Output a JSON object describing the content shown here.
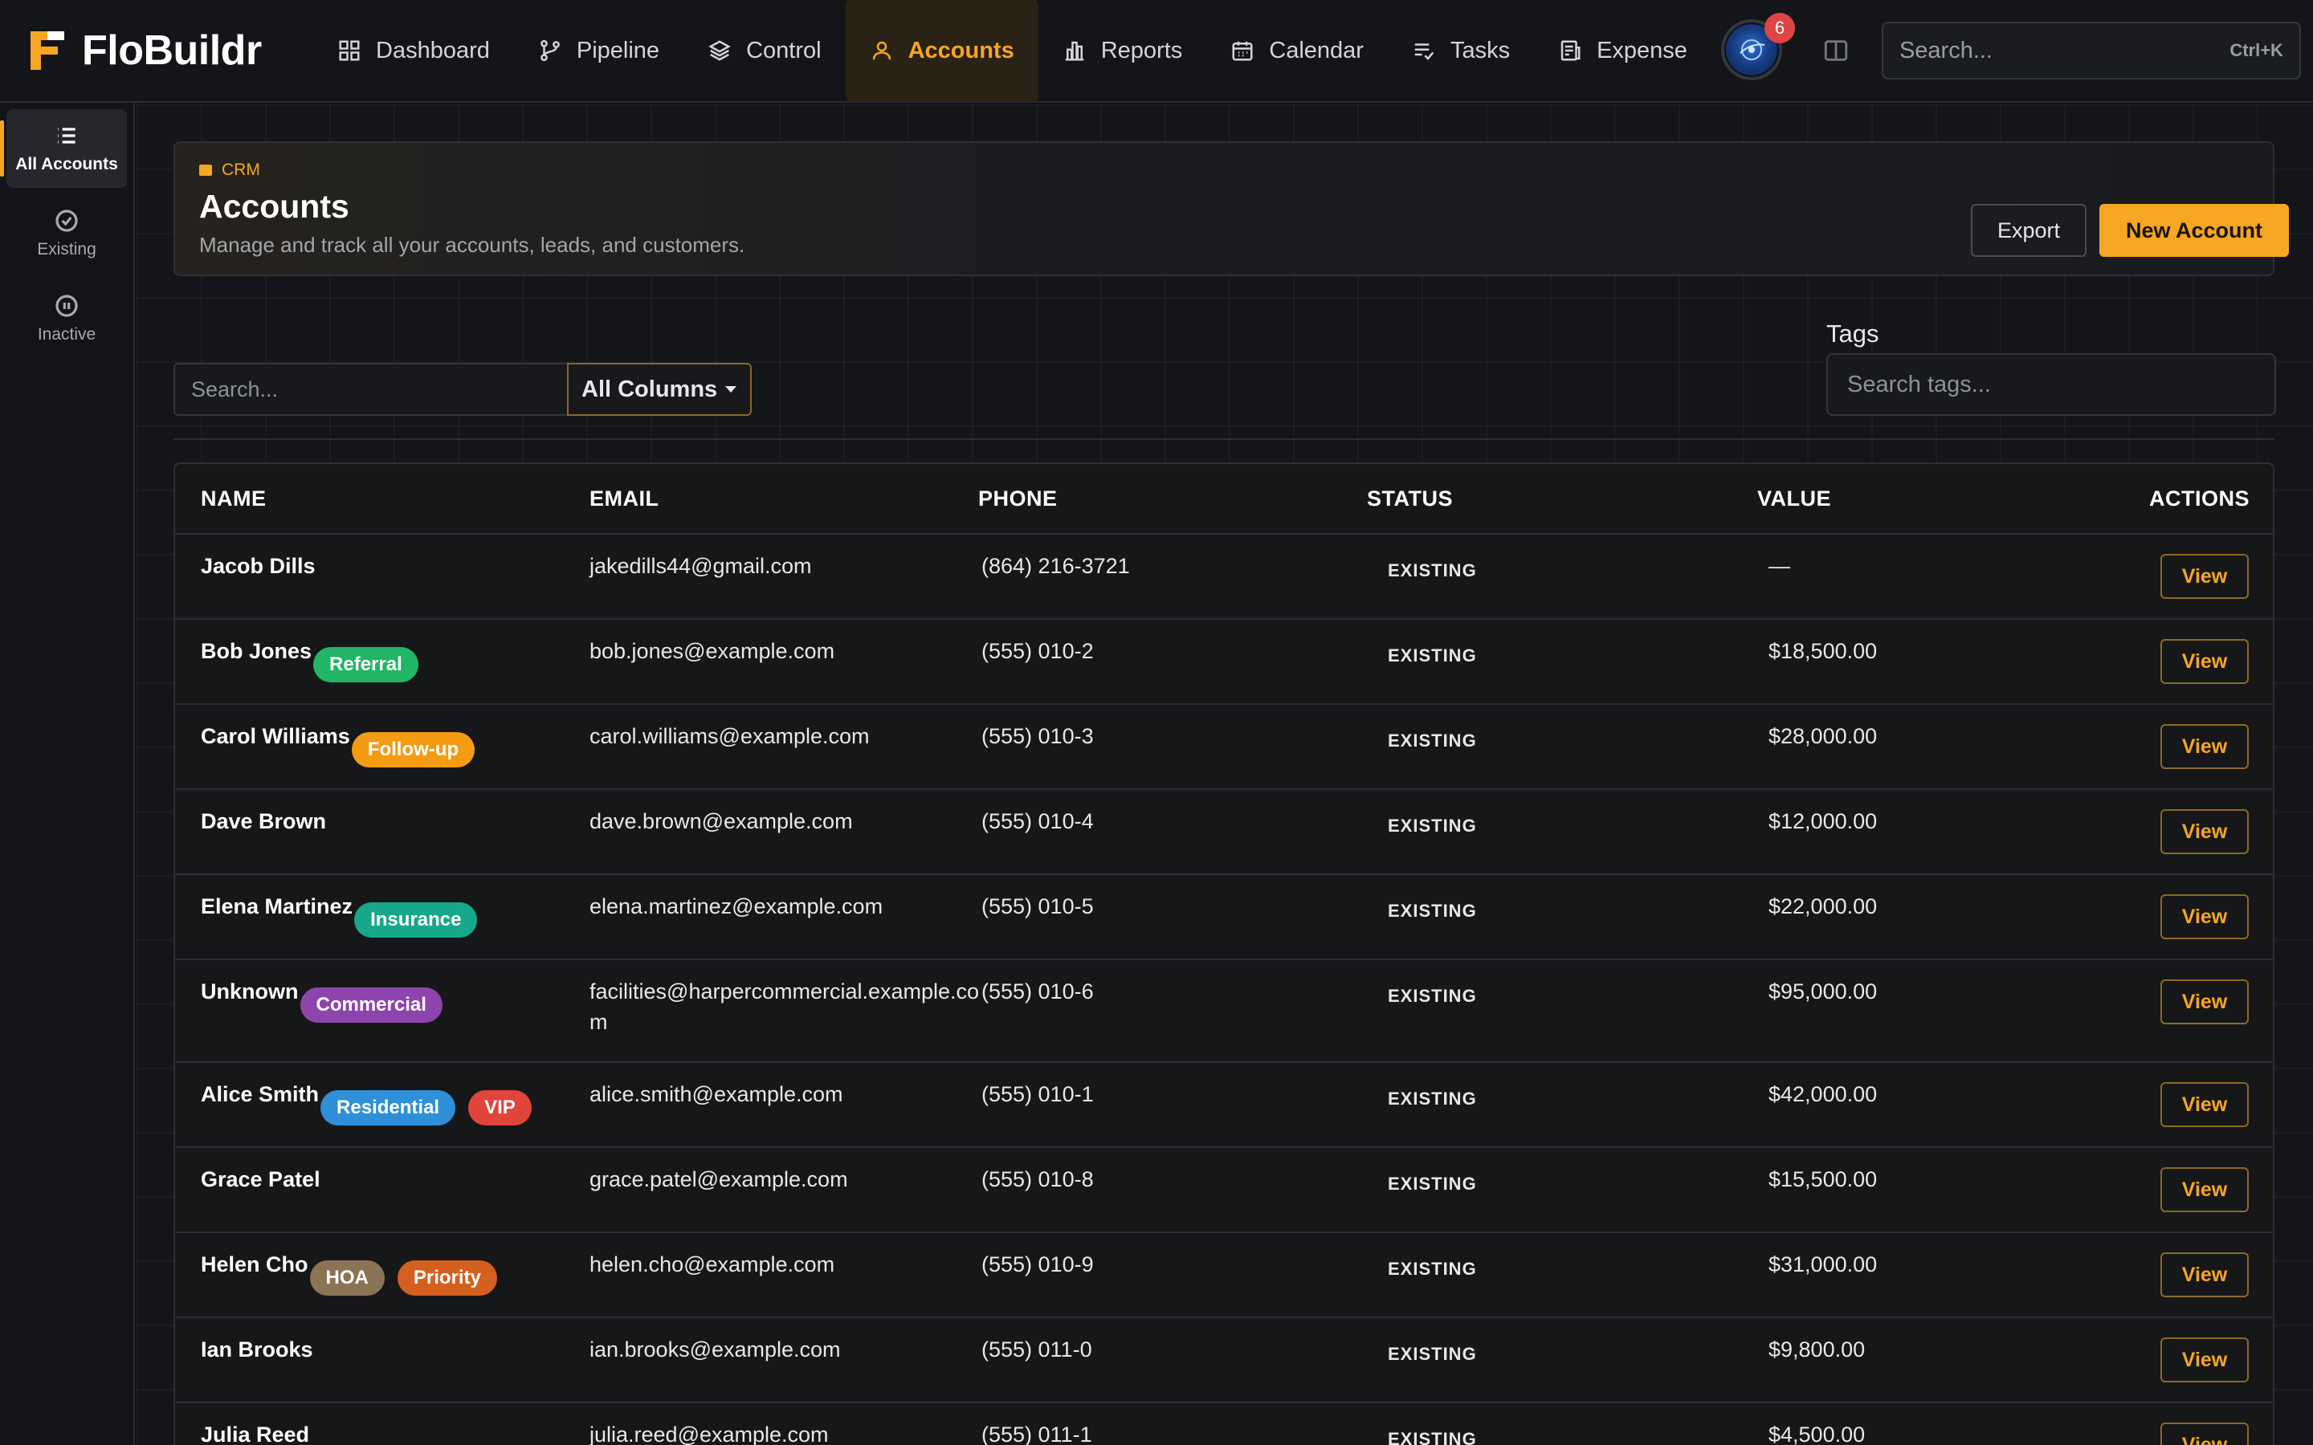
{
  "app": {
    "name": "FloBuildr"
  },
  "nav": {
    "items": [
      {
        "label": "Dashboard",
        "icon": "grid-icon"
      },
      {
        "label": "Pipeline",
        "icon": "branch-icon"
      },
      {
        "label": "Control",
        "icon": "layers-icon"
      },
      {
        "label": "Accounts",
        "icon": "user-icon",
        "active": true
      },
      {
        "label": "Reports",
        "icon": "bar-chart-icon"
      },
      {
        "label": "Calendar",
        "icon": "calendar-icon"
      },
      {
        "label": "Tasks",
        "icon": "list-check-icon"
      },
      {
        "label": "Expense",
        "icon": "receipt-icon"
      }
    ],
    "notification_count": "6",
    "search_placeholder": "Search...",
    "search_shortcut": "Ctrl+K"
  },
  "sidebar": {
    "items": [
      {
        "label": "All Accounts",
        "icon": "list-icon",
        "active": true
      },
      {
        "label": "Existing",
        "icon": "check-circle-icon"
      },
      {
        "label": "Inactive",
        "icon": "pause-circle-icon"
      }
    ]
  },
  "header": {
    "crumb": "CRM",
    "title": "Accounts",
    "subtitle": "Manage and track all your accounts, leads, and customers.",
    "export_label": "Export",
    "new_label": "New Account"
  },
  "filters": {
    "search_placeholder": "Search...",
    "column_select": "All Columns",
    "tags_label": "Tags",
    "tags_placeholder": "Search tags..."
  },
  "table": {
    "columns": {
      "name": "NAME",
      "email": "EMAIL",
      "phone": "PHONE",
      "status": "STATUS",
      "value": "VALUE",
      "actions": "ACTIONS"
    },
    "view_label": "View",
    "rows": [
      {
        "name": "Jacob Dills",
        "tags": [],
        "email": "jakedills44@gmail.com",
        "phone": "(864) 216-3721",
        "status": "EXISTING",
        "value": "—"
      },
      {
        "name": "Bob Jones",
        "tags": [
          {
            "label": "Referral",
            "color": "#22b565"
          }
        ],
        "email": "bob.jones@example.com",
        "phone": "(555) 010-2",
        "status": "EXISTING",
        "value": "$18,500.00"
      },
      {
        "name": "Carol Williams",
        "tags": [
          {
            "label": "Follow-up",
            "color": "#f39c12"
          }
        ],
        "email": "carol.williams@example.com",
        "phone": "(555) 010-3",
        "status": "EXISTING",
        "value": "$28,000.00"
      },
      {
        "name": "Dave Brown",
        "tags": [],
        "email": "dave.brown@example.com",
        "phone": "(555) 010-4",
        "status": "EXISTING",
        "value": "$12,000.00"
      },
      {
        "name": "Elena Martinez",
        "tags": [
          {
            "label": "Insurance",
            "color": "#17a88a"
          }
        ],
        "email": "elena.martinez@example.com",
        "phone": "(555) 010-5",
        "status": "EXISTING",
        "value": "$22,000.00"
      },
      {
        "name": "Unknown",
        "tags": [
          {
            "label": "Commercial",
            "color": "#8e44ad"
          }
        ],
        "email": "facilities@harpercommercial.example.com",
        "phone": "(555) 010-6",
        "status": "EXISTING",
        "value": "$95,000.00"
      },
      {
        "name": "Alice Smith",
        "tags": [
          {
            "label": "Residential",
            "color": "#2f8fd8"
          },
          {
            "label": "VIP",
            "color": "#e0443a"
          }
        ],
        "email": "alice.smith@example.com",
        "phone": "(555) 010-1",
        "status": "EXISTING",
        "value": "$42,000.00"
      },
      {
        "name": "Grace Patel",
        "tags": [],
        "email": "grace.patel@example.com",
        "phone": "(555) 010-8",
        "status": "EXISTING",
        "value": "$15,500.00"
      },
      {
        "name": "Helen Cho",
        "tags": [
          {
            "label": "HOA",
            "color": "#8b7355"
          },
          {
            "label": "Priority",
            "color": "#d4601f"
          }
        ],
        "email": "helen.cho@example.com",
        "phone": "(555) 010-9",
        "status": "EXISTING",
        "value": "$31,000.00"
      },
      {
        "name": "Ian Brooks",
        "tags": [],
        "email": "ian.brooks@example.com",
        "phone": "(555) 011-0",
        "status": "EXISTING",
        "value": "$9,800.00"
      },
      {
        "name": "Julia Reed",
        "tags": [],
        "email": "julia.reed@example.com",
        "phone": "(555) 011-1",
        "status": "EXISTING",
        "value": "$4,500.00"
      }
    ]
  },
  "colors": {
    "accent": "#f5a623",
    "background": "#141518"
  }
}
